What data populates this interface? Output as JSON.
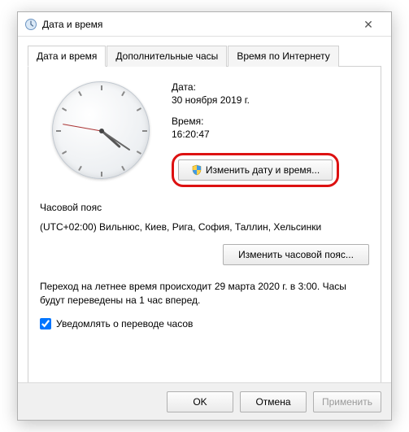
{
  "window": {
    "title": "Дата и время"
  },
  "tabs": {
    "t0": "Дата и время",
    "t1": "Дополнительные часы",
    "t2": "Время по Интернету"
  },
  "date": {
    "label": "Дата:",
    "value": "30 ноября 2019 г."
  },
  "time": {
    "label": "Время:",
    "value": "16:20:47"
  },
  "buttons": {
    "change_dt": "Изменить дату и время...",
    "change_tz": "Изменить часовой пояс...",
    "ok": "OK",
    "cancel": "Отмена",
    "apply": "Применить"
  },
  "tz": {
    "heading": "Часовой пояс",
    "value": "(UTC+02:00) Вильнюс, Киев, Рига, София, Таллин, Хельсинки"
  },
  "dst": {
    "text": "Переход на летнее время происходит 29 марта 2020 г. в 3:00. Часы будут переведены на 1 час вперед.",
    "checkbox_label": "Уведомлять о переводе часов"
  }
}
